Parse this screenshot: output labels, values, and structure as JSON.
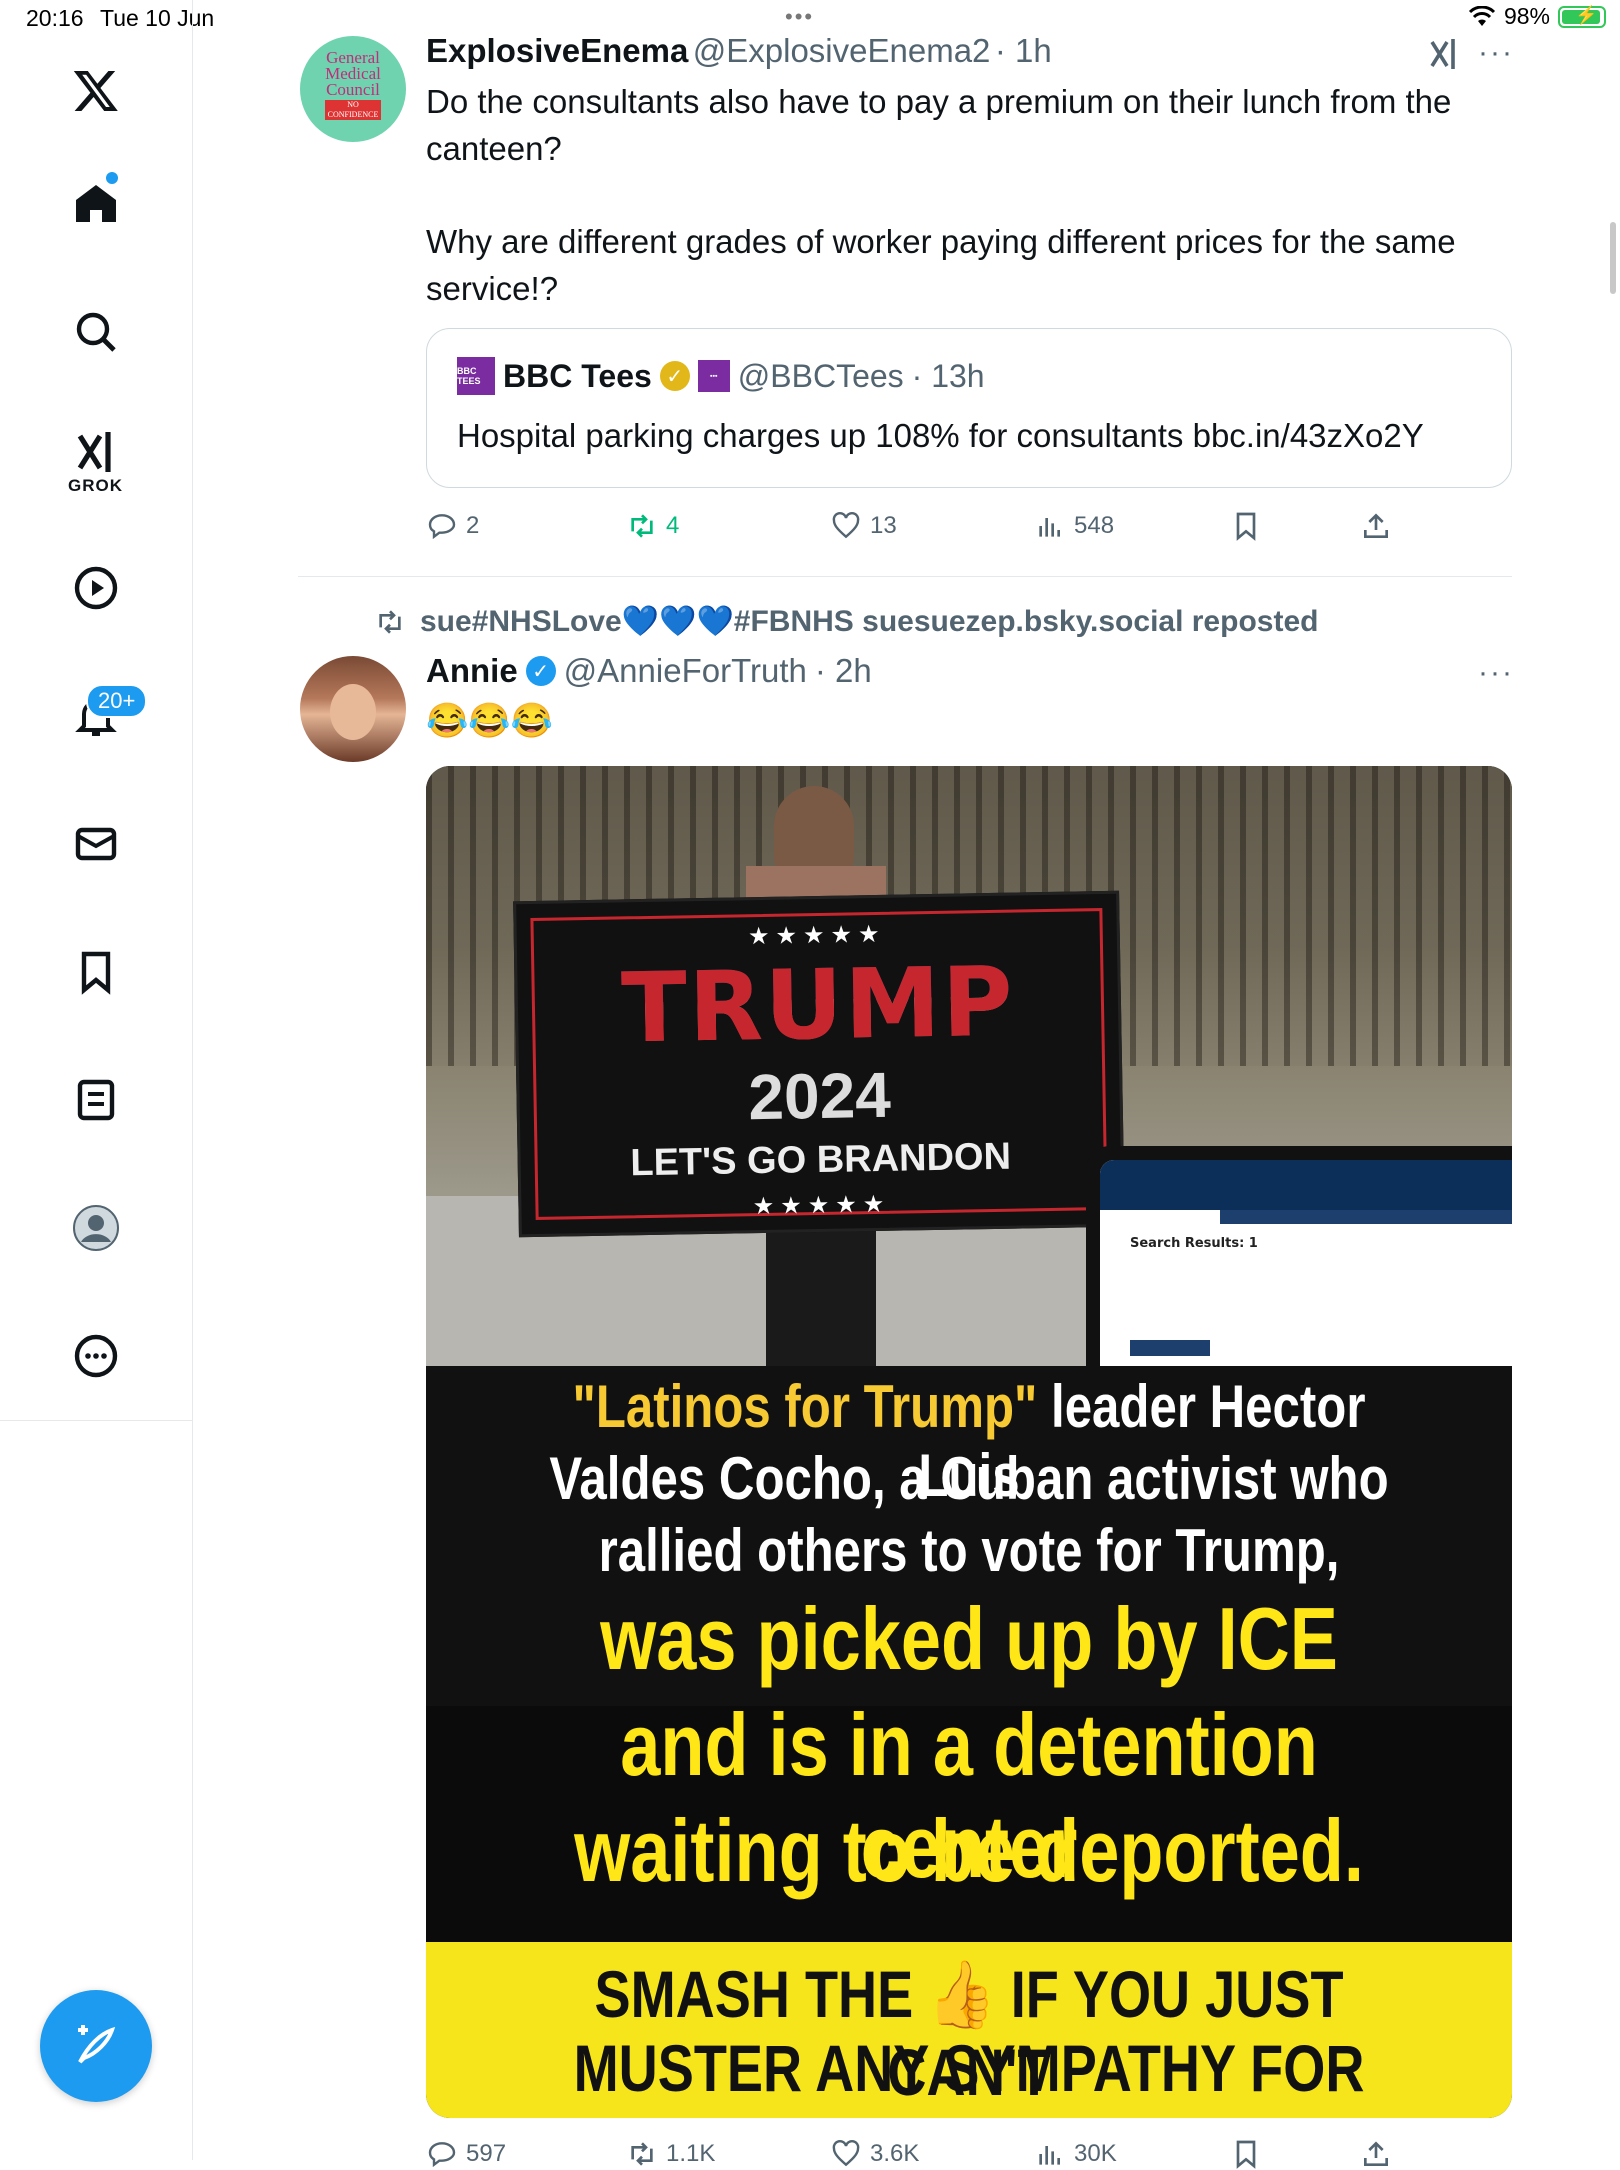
{
  "status_bar": {
    "time": "20:16",
    "date": "Tue 10 Jun",
    "battery": "98%",
    "multitask_dots": "•••"
  },
  "sidebar": {
    "logo": "x-logo-icon",
    "items": [
      {
        "icon": "home-icon"
      },
      {
        "icon": "search-icon"
      },
      {
        "icon": "grok-icon",
        "label": "GROK"
      },
      {
        "icon": "video-icon"
      },
      {
        "icon": "bell-icon",
        "badge": "20+"
      },
      {
        "icon": "mail-icon"
      },
      {
        "icon": "bookmark-icon"
      },
      {
        "icon": "list-icon"
      },
      {
        "icon": "profile-icon"
      },
      {
        "icon": "more-icon"
      }
    ],
    "compose": "compose-icon"
  },
  "tweet1": {
    "name": "ExplosiveEnema",
    "handle": "@ExplosiveEnema2",
    "time": "· 1h",
    "avatar_text": [
      "General",
      "Medical",
      "Council",
      "NO CONFIDENCE"
    ],
    "text_lines": [
      "Do the consultants also have to pay a premium on their lunch from the",
      "canteen?",
      "Why are different grades of worker paying different prices for the same",
      "service!?"
    ],
    "quote": {
      "name": "BBC Tees",
      "handle": "@BBCTees",
      "time": "· 13h",
      "logo_text": "BBC TEES",
      "text": "Hospital parking charges up 108% for consultants bbc.in/43zXo2Y"
    },
    "actions": {
      "replies": "2",
      "reposts": "4",
      "likes": "13",
      "views": "548"
    }
  },
  "tweet2": {
    "repost_by": "sue#NHSLove💙💙💙#FBNHS suesuezep.bsky.social reposted",
    "name": "Annie",
    "handle": "@AnnieForTruth",
    "time": "· 2h",
    "text": "😂😂😂",
    "image": {
      "flag_stars": "★★★★★",
      "flag_title": "TRUMP",
      "flag_year": "2024",
      "flag_slogan": "LET'S GO BRANDON",
      "screen_title": "Search Results: 1",
      "caption_line1_quote": "\"Latinos for Trump\"",
      "caption_line1_rest": " leader Hector Luis",
      "caption_line2": "Valdes Cocho, a Cuban activist who",
      "caption_line3": "rallied others to vote for Trump,",
      "caption_line4": "was picked up by ICE",
      "caption_line5": "and is in a detention center",
      "caption_line6": "waiting to be deported.",
      "banner_line1_a": "SMASH THE",
      "banner_emoji": "👍",
      "banner_line1_b": "IF YOU JUST CAN'T",
      "banner_line2": "MUSTER ANY SYMPATHY FOR HIM!"
    },
    "actions": {
      "replies": "597",
      "reposts": "1.1K",
      "likes": "3.6K",
      "views": "30K"
    }
  }
}
